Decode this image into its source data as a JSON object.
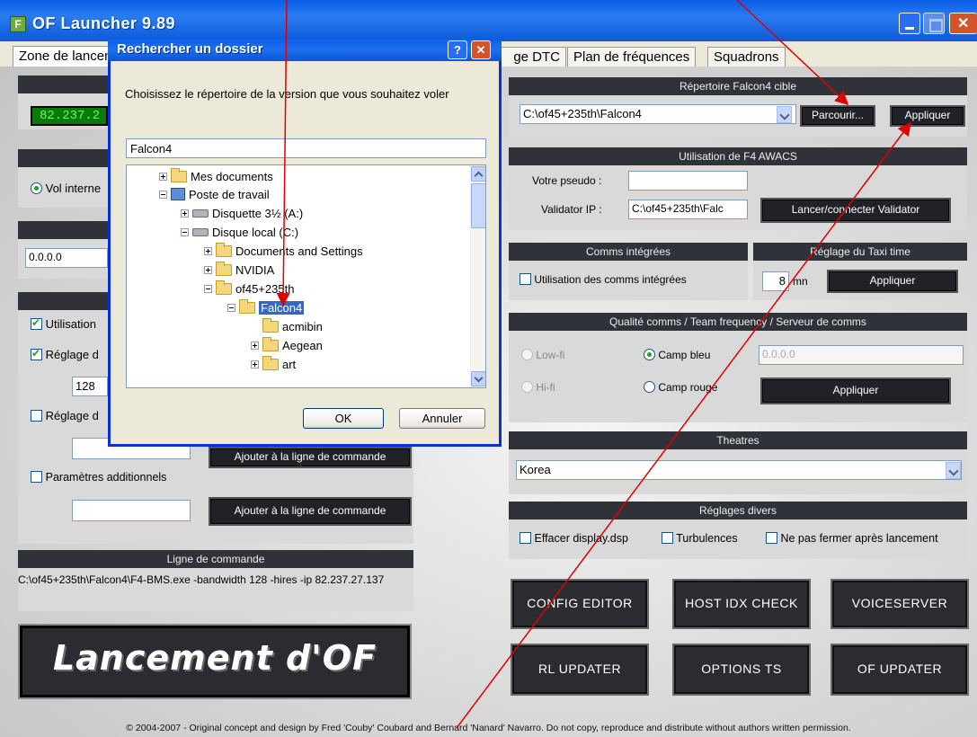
{
  "window": {
    "title": "OF Launcher 9.89",
    "tabs": [
      "Zone de lancement",
      "ge DTC",
      "Plan de fréquences",
      "Squadrons"
    ]
  },
  "left": {
    "ip_value": "82.237.2",
    "vol_label": "Vol interne",
    "ip_field": "0.0.0.0",
    "util_label": "Utilisation",
    "reglage_label1": "Réglage d",
    "bandwidth_value": "128",
    "reglage_label2": "Réglage d",
    "add_cmd_label": "Ajouter à la ligne de commande",
    "params_label": "Paramètres additionnels",
    "cmd_header": "Ligne de commande",
    "cmd_line": "C:\\of45+235th\\Falcon4\\F4-BMS.exe -bandwidth 128 -hires -ip 82.237.27.137",
    "launch_label": "Lancement d'OF"
  },
  "right": {
    "rep_header": "Répertoire Falcon4 cible",
    "rep_value": "C:\\of45+235th\\Falcon4",
    "browse_label": "Parcourir...",
    "apply_label": "Appliquer",
    "awacs_header": "Utilisation de F4 AWACS",
    "pseudo_label": "Votre pseudo :",
    "validator_label": "Validator IP :",
    "validator_value": "C:\\of45+235th\\Falc",
    "launch_validator_label": "Lancer/connecter Validator",
    "comms_header": "Comms intégrées",
    "comms_check_label": "Utilisation des comms intégrées",
    "taxi_header": "Réglage du  Taxi time",
    "taxi_value": "8",
    "taxi_unit": "mn",
    "taxi_apply": "Appliquer",
    "quality_header": "Qualité comms / Team frequency / Serveur de comms",
    "lowfi": "Low-fi",
    "hifi": "Hi-fi",
    "camp_bleu": "Camp bleu",
    "camp_rouge": "Camp rouge",
    "server_ip": "0.0.0.0",
    "quality_apply": "Appliquer",
    "theatres_header": "Theatres",
    "theatre_value": "Korea",
    "divers_header": "Réglages divers",
    "divers_opts": [
      "Effacer display.dsp",
      "Turbulences",
      "Ne pas fermer après lancement"
    ],
    "buttons": [
      "CONFIG EDITOR",
      "HOST IDX CHECK",
      "VOICESERVER",
      "RL UPDATER",
      "OPTIONS TS",
      "OF UPDATER"
    ]
  },
  "dialog": {
    "title": "Rechercher un dossier",
    "help": "?",
    "instruction": "Choisissez le répertoire de la version que vous souhaitez voler",
    "folder_value": "Falcon4",
    "tree": [
      "Mes documents",
      "Poste de travail",
      "Disquette 3½ (A:)",
      "Disque local (C:)",
      "Documents and Settings",
      "NVIDIA",
      "of45+235th",
      "Falcon4",
      "acmibin",
      "Aegean",
      "art"
    ],
    "ok": "OK",
    "cancel": "Annuler"
  },
  "footer": "© 2004-2007 - Original concept and design by Fred 'Couby' Coubard and Bernard 'Nanard' Navarro. Do not copy, reproduce and distribute without authors written permission.",
  "colors": {
    "titlebar": "#0a5de6",
    "annotation_arrow": "#e00000",
    "ip_green": "#1fbf1f",
    "dark_button": "#202227"
  }
}
